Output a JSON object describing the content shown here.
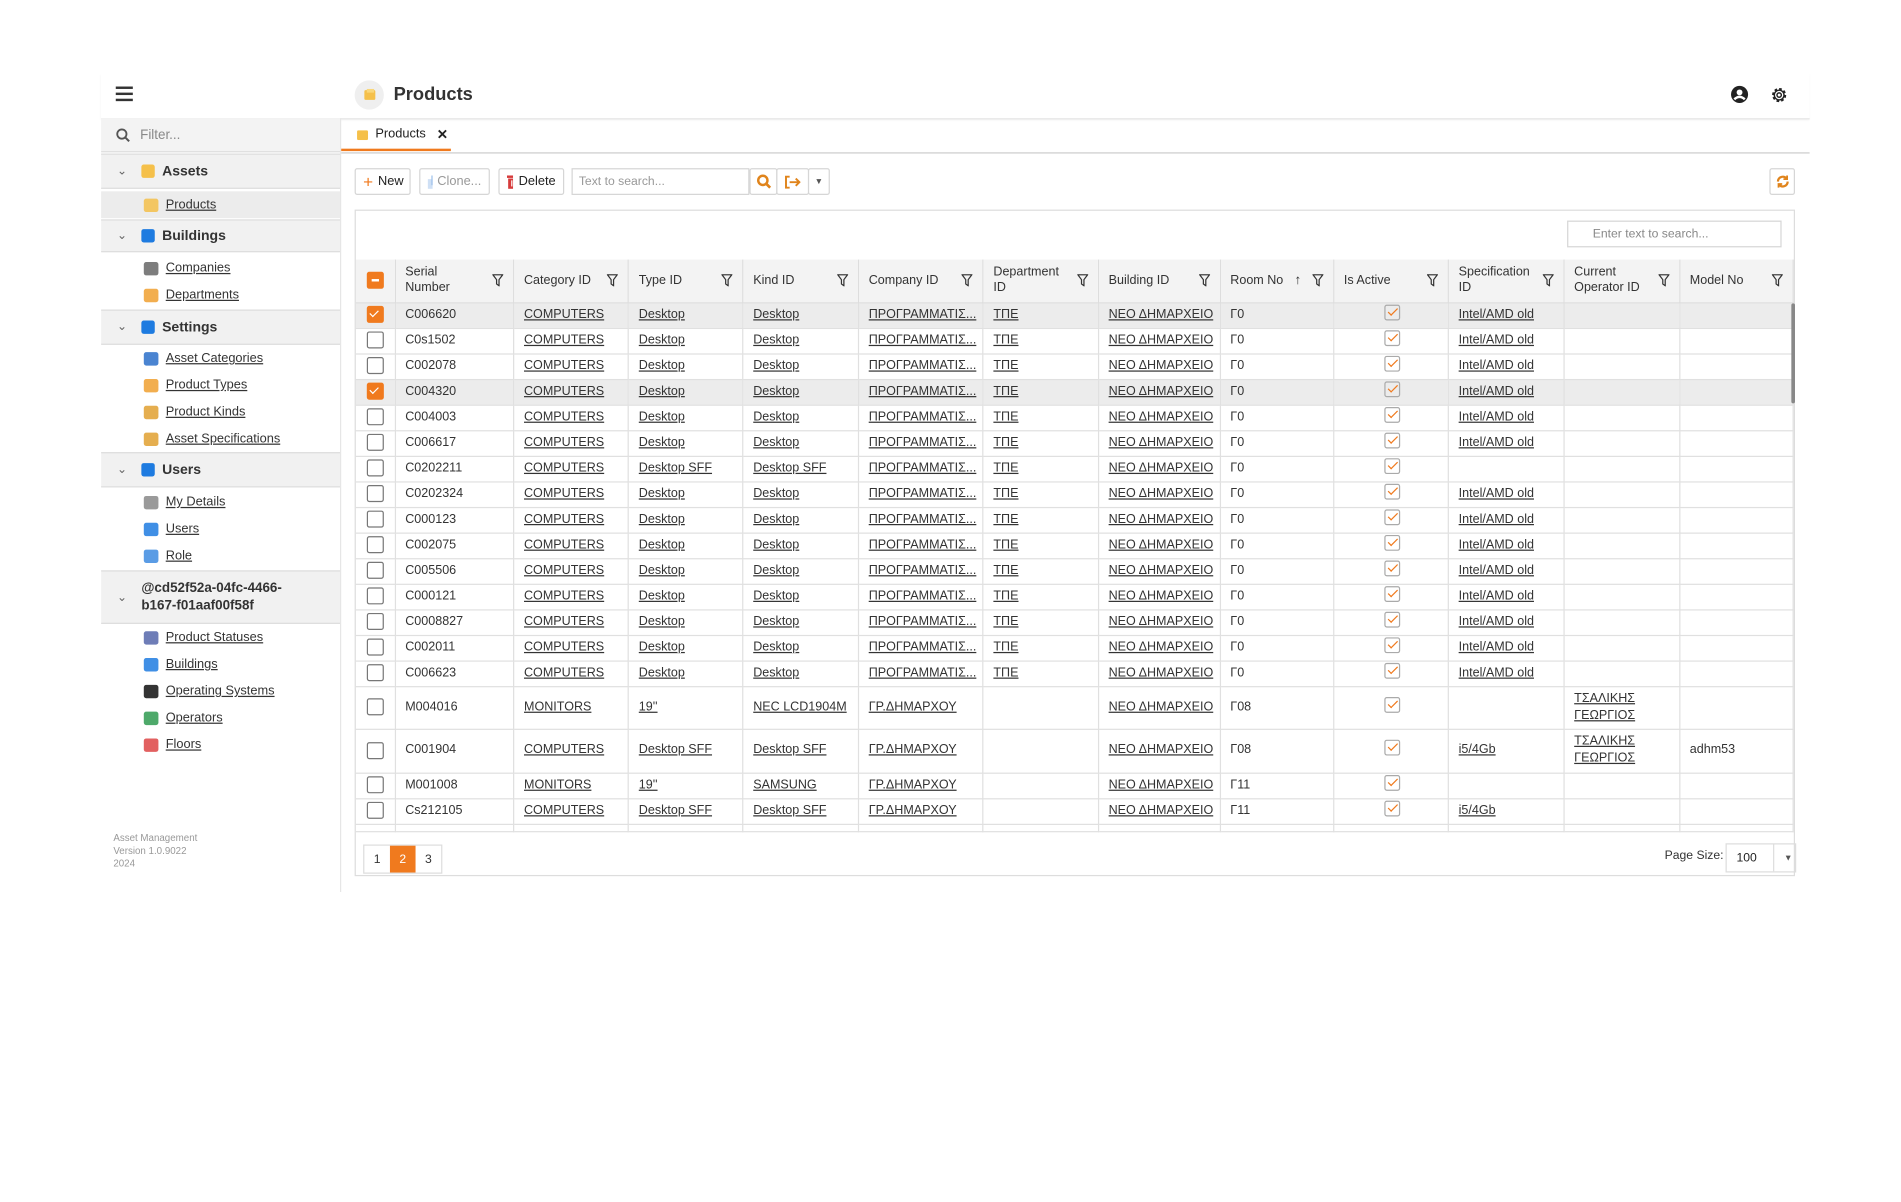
{
  "header": {
    "title": "Products",
    "icons": [
      "menu-icon",
      "products-icon",
      "user-icon",
      "gear-icon"
    ]
  },
  "sidebar": {
    "filter_placeholder": "Filter...",
    "groups": [
      {
        "label": "Assets",
        "items": [
          "Products"
        ]
      },
      {
        "label": "Buildings",
        "items": [
          "Companies",
          "Departments"
        ]
      },
      {
        "label": "Settings",
        "items": [
          "Asset Categories",
          "Product Types",
          "Product Kinds",
          "Asset Specifications"
        ]
      },
      {
        "label": "Users",
        "items": [
          "My Details",
          "Users",
          "Role"
        ]
      },
      {
        "label": "@cd52f52a-04fc-4466-b167-f01aaf00f58f",
        "items": [
          "Product Statuses",
          "Buildings",
          "Operating Systems",
          "Operators",
          "Floors"
        ]
      }
    ],
    "selected": "Products",
    "footer": [
      "Asset Management",
      "Version 1.0.9022",
      "2024"
    ]
  },
  "tabs": [
    {
      "label": "Products",
      "active": true
    }
  ],
  "toolbar": {
    "new": "New",
    "clone": "Clone...",
    "delete": "Delete",
    "search_placeholder": "Text to search..."
  },
  "grid": {
    "search_placeholder": "Enter text to search...",
    "columns": [
      "Serial Number",
      "Category ID",
      "Type ID",
      "Kind ID",
      "Company ID",
      "Department ID",
      "Building ID",
      "Room No",
      "Is Active",
      "Specification ID",
      "Current Operator ID",
      "Model No"
    ],
    "sorted_column": "Room No",
    "sort_direction": "ascending",
    "rows": [
      {
        "selected": true,
        "serial": "C006620",
        "category": "COMPUTERS",
        "type": "Desktop",
        "kind": "Desktop",
        "company": "ΠΡΟΓΡΑΜΜΑΤΙΣ...",
        "dept": "ΤΠΕ",
        "building": "ΝΕΟ ΔΗΜΑΡΧΕΙΟ",
        "room": "Γ0",
        "active": true,
        "spec": "Intel/AMD old",
        "operator": "",
        "model": ""
      },
      {
        "selected": false,
        "serial": "C0s1502",
        "category": "COMPUTERS",
        "type": "Desktop",
        "kind": "Desktop",
        "company": "ΠΡΟΓΡΑΜΜΑΤΙΣ...",
        "dept": "ΤΠΕ",
        "building": "ΝΕΟ ΔΗΜΑΡΧΕΙΟ",
        "room": "Γ0",
        "active": true,
        "spec": "Intel/AMD old",
        "operator": "",
        "model": ""
      },
      {
        "selected": false,
        "serial": "C002078",
        "category": "COMPUTERS",
        "type": "Desktop",
        "kind": "Desktop",
        "company": "ΠΡΟΓΡΑΜΜΑΤΙΣ...",
        "dept": "ΤΠΕ",
        "building": "ΝΕΟ ΔΗΜΑΡΧΕΙΟ",
        "room": "Γ0",
        "active": true,
        "spec": "Intel/AMD old",
        "operator": "",
        "model": ""
      },
      {
        "selected": true,
        "serial": "C004320",
        "category": "COMPUTERS",
        "type": "Desktop",
        "kind": "Desktop",
        "company": "ΠΡΟΓΡΑΜΜΑΤΙΣ...",
        "dept": "ΤΠΕ",
        "building": "ΝΕΟ ΔΗΜΑΡΧΕΙΟ",
        "room": "Γ0",
        "active": true,
        "spec": "Intel/AMD old",
        "operator": "",
        "model": ""
      },
      {
        "selected": false,
        "serial": "C004003",
        "category": "COMPUTERS",
        "type": "Desktop",
        "kind": "Desktop",
        "company": "ΠΡΟΓΡΑΜΜΑΤΙΣ...",
        "dept": "ΤΠΕ",
        "building": "ΝΕΟ ΔΗΜΑΡΧΕΙΟ",
        "room": "Γ0",
        "active": true,
        "spec": "Intel/AMD old",
        "operator": "",
        "model": ""
      },
      {
        "selected": false,
        "serial": "C006617",
        "category": "COMPUTERS",
        "type": "Desktop",
        "kind": "Desktop",
        "company": "ΠΡΟΓΡΑΜΜΑΤΙΣ...",
        "dept": "ΤΠΕ",
        "building": "ΝΕΟ ΔΗΜΑΡΧΕΙΟ",
        "room": "Γ0",
        "active": true,
        "spec": "Intel/AMD old",
        "operator": "",
        "model": ""
      },
      {
        "selected": false,
        "serial": "C0202211",
        "category": "COMPUTERS",
        "type": "Desktop SFF",
        "kind": "Desktop SFF",
        "company": "ΠΡΟΓΡΑΜΜΑΤΙΣ...",
        "dept": "ΤΠΕ",
        "building": "ΝΕΟ ΔΗΜΑΡΧΕΙΟ",
        "room": "Γ0",
        "active": true,
        "spec": "",
        "operator": "",
        "model": ""
      },
      {
        "selected": false,
        "serial": "C0202324",
        "category": "COMPUTERS",
        "type": "Desktop",
        "kind": "Desktop",
        "company": "ΠΡΟΓΡΑΜΜΑΤΙΣ...",
        "dept": "ΤΠΕ",
        "building": "ΝΕΟ ΔΗΜΑΡΧΕΙΟ",
        "room": "Γ0",
        "active": true,
        "spec": "Intel/AMD old",
        "operator": "",
        "model": ""
      },
      {
        "selected": false,
        "serial": "C000123",
        "category": "COMPUTERS",
        "type": "Desktop",
        "kind": "Desktop",
        "company": "ΠΡΟΓΡΑΜΜΑΤΙΣ...",
        "dept": "ΤΠΕ",
        "building": "ΝΕΟ ΔΗΜΑΡΧΕΙΟ",
        "room": "Γ0",
        "active": true,
        "spec": "Intel/AMD old",
        "operator": "",
        "model": ""
      },
      {
        "selected": false,
        "serial": "C002075",
        "category": "COMPUTERS",
        "type": "Desktop",
        "kind": "Desktop",
        "company": "ΠΡΟΓΡΑΜΜΑΤΙΣ...",
        "dept": "ΤΠΕ",
        "building": "ΝΕΟ ΔΗΜΑΡΧΕΙΟ",
        "room": "Γ0",
        "active": true,
        "spec": "Intel/AMD old",
        "operator": "",
        "model": ""
      },
      {
        "selected": false,
        "serial": "C005506",
        "category": "COMPUTERS",
        "type": "Desktop",
        "kind": "Desktop",
        "company": "ΠΡΟΓΡΑΜΜΑΤΙΣ...",
        "dept": "ΤΠΕ",
        "building": "ΝΕΟ ΔΗΜΑΡΧΕΙΟ",
        "room": "Γ0",
        "active": true,
        "spec": "Intel/AMD old",
        "operator": "",
        "model": ""
      },
      {
        "selected": false,
        "serial": "C000121",
        "category": "COMPUTERS",
        "type": "Desktop",
        "kind": "Desktop",
        "company": "ΠΡΟΓΡΑΜΜΑΤΙΣ...",
        "dept": "ΤΠΕ",
        "building": "ΝΕΟ ΔΗΜΑΡΧΕΙΟ",
        "room": "Γ0",
        "active": true,
        "spec": "Intel/AMD old",
        "operator": "",
        "model": ""
      },
      {
        "selected": false,
        "serial": "C0008827",
        "category": "COMPUTERS",
        "type": "Desktop",
        "kind": "Desktop",
        "company": "ΠΡΟΓΡΑΜΜΑΤΙΣ...",
        "dept": "ΤΠΕ",
        "building": "ΝΕΟ ΔΗΜΑΡΧΕΙΟ",
        "room": "Γ0",
        "active": true,
        "spec": "Intel/AMD old",
        "operator": "",
        "model": ""
      },
      {
        "selected": false,
        "serial": "C002011",
        "category": "COMPUTERS",
        "type": "Desktop",
        "kind": "Desktop",
        "company": "ΠΡΟΓΡΑΜΜΑΤΙΣ...",
        "dept": "ΤΠΕ",
        "building": "ΝΕΟ ΔΗΜΑΡΧΕΙΟ",
        "room": "Γ0",
        "active": true,
        "spec": "Intel/AMD old",
        "operator": "",
        "model": ""
      },
      {
        "selected": false,
        "serial": "C006623",
        "category": "COMPUTERS",
        "type": "Desktop",
        "kind": "Desktop",
        "company": "ΠΡΟΓΡΑΜΜΑΤΙΣ...",
        "dept": "ΤΠΕ",
        "building": "ΝΕΟ ΔΗΜΑΡΧΕΙΟ",
        "room": "Γ0",
        "active": true,
        "spec": "Intel/AMD old",
        "operator": "",
        "model": ""
      },
      {
        "selected": false,
        "serial": "M004016",
        "category": "MONITORS",
        "type": "19''",
        "kind": "NEC LCD1904M",
        "company": "ΓΡ.ΔΗΜΑΡΧΟΥ",
        "dept": "",
        "building": "ΝΕΟ ΔΗΜΑΡΧΕΙΟ",
        "room": "Γ08",
        "active": true,
        "spec": "",
        "operator": "ΤΣΑΛΙΚΗΣ ΓΕΩΡΓΙΟΣ",
        "model": ""
      },
      {
        "selected": false,
        "serial": "C001904",
        "category": "COMPUTERS",
        "type": "Desktop SFF",
        "kind": "Desktop SFF",
        "company": "ΓΡ.ΔΗΜΑΡΧΟΥ",
        "dept": "",
        "building": "ΝΕΟ ΔΗΜΑΡΧΕΙΟ",
        "room": "Γ08",
        "active": true,
        "spec": "i5/4Gb",
        "operator": "ΤΣΑΛΙΚΗΣ ΓΕΩΡΓΙΟΣ",
        "model": "adhm53"
      },
      {
        "selected": false,
        "serial": "M001008",
        "category": "MONITORS",
        "type": "19''",
        "kind": "SAMSUNG",
        "company": "ΓΡ.ΔΗΜΑΡΧΟΥ",
        "dept": "",
        "building": "ΝΕΟ ΔΗΜΑΡΧΕΙΟ",
        "room": "Γ11",
        "active": true,
        "spec": "",
        "operator": "",
        "model": ""
      },
      {
        "selected": false,
        "serial": "Cs212105",
        "category": "COMPUTERS",
        "type": "Desktop SFF",
        "kind": "Desktop SFF",
        "company": "ΓΡ.ΔΗΜΑΡΧΟΥ",
        "dept": "",
        "building": "ΝΕΟ ΔΗΜΑΡΧΕΙΟ",
        "room": "Γ11",
        "active": true,
        "spec": "i5/4Gb",
        "operator": "",
        "model": ""
      }
    ]
  },
  "pager": {
    "pages": [
      "1",
      "2",
      "3"
    ],
    "current": "2",
    "page_size_label": "Page Size:",
    "page_size": "100"
  },
  "colors": {
    "accent": "#f07a1e",
    "selected_row": "#ececec",
    "header_bg": "#f3f3f3"
  }
}
